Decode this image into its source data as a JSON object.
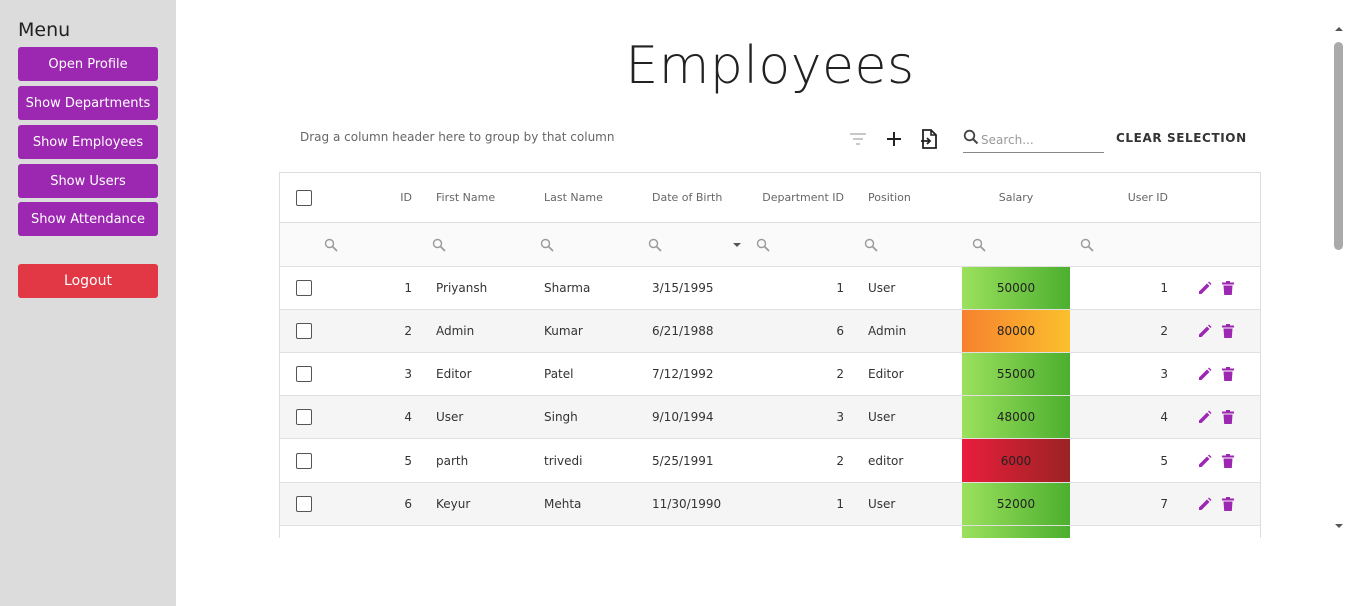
{
  "sidebar": {
    "menu_title": "Menu",
    "items": [
      {
        "label": "Open Profile"
      },
      {
        "label": "Show Departments"
      },
      {
        "label": "Show Employees"
      },
      {
        "label": "Show Users"
      },
      {
        "label": "Show Attendance"
      }
    ],
    "logout_label": "Logout"
  },
  "page": {
    "title": "Employees"
  },
  "toolbar": {
    "group_panel_text": "Drag a column header here to group by that column",
    "search_placeholder": "Search...",
    "clear_selection_label": "CLEAR SELECTION",
    "icons": [
      "filter-icon",
      "add-icon",
      "export-icon",
      "search-icon"
    ]
  },
  "grid": {
    "columns": [
      "ID",
      "First Name",
      "Last Name",
      "Date of Birth",
      "Department ID",
      "Position",
      "Salary",
      "User ID"
    ],
    "rows": [
      {
        "id": "1",
        "first": "Priyansh",
        "last": "Sharma",
        "dob": "3/15/1995",
        "dept": "1",
        "position": "User",
        "salary": "50000",
        "user_id": "1",
        "salary_level": "green"
      },
      {
        "id": "2",
        "first": "Admin",
        "last": "Kumar",
        "dob": "6/21/1988",
        "dept": "6",
        "position": "Admin",
        "salary": "80000",
        "user_id": "2",
        "salary_level": "orange"
      },
      {
        "id": "3",
        "first": "Editor",
        "last": "Patel",
        "dob": "7/12/1992",
        "dept": "2",
        "position": "Editor",
        "salary": "55000",
        "user_id": "3",
        "salary_level": "green"
      },
      {
        "id": "4",
        "first": "User",
        "last": "Singh",
        "dob": "9/10/1994",
        "dept": "3",
        "position": "User",
        "salary": "48000",
        "user_id": "4",
        "salary_level": "green"
      },
      {
        "id": "5",
        "first": "parth",
        "last": "trivedi",
        "dob": "5/25/1991",
        "dept": "2",
        "position": "editor",
        "salary": "6000",
        "user_id": "5",
        "salary_level": "red"
      },
      {
        "id": "6",
        "first": "Keyur",
        "last": "Mehta",
        "dob": "11/30/1990",
        "dept": "1",
        "position": "User",
        "salary": "52000",
        "user_id": "7",
        "salary_level": "green"
      }
    ]
  },
  "colors": {
    "primary": "#9c27b0",
    "logout": "#e23744",
    "salary_green": [
      "#9be15d",
      "#4caf2f"
    ],
    "salary_orange": [
      "#f7812e",
      "#fbc02d"
    ],
    "salary_red": [
      "#e91e3c",
      "#9b2323"
    ]
  }
}
